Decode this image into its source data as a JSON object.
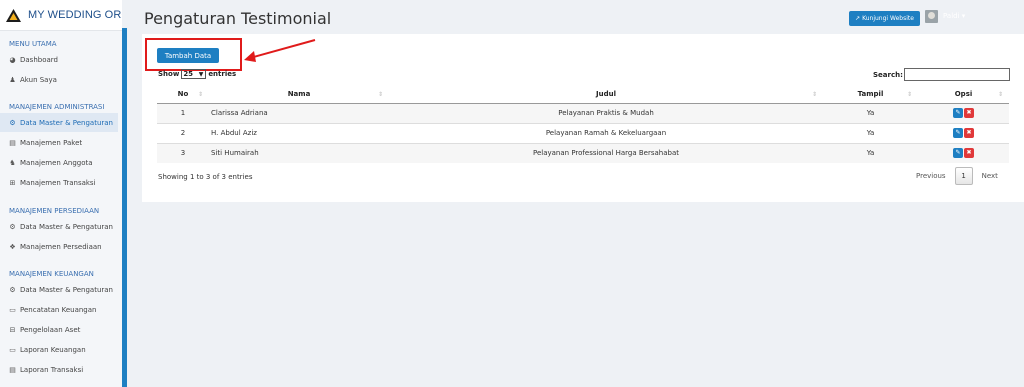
{
  "brand": {
    "name": "MY WEDDING ORGAN"
  },
  "sidebar": {
    "sections": [
      {
        "title": "MENU UTAMA",
        "items": [
          {
            "label": "Dashboard",
            "icon": "dashboard-icon",
            "glyph": "◕"
          },
          {
            "label": "Akun Saya",
            "icon": "user-icon",
            "glyph": "♟"
          }
        ]
      },
      {
        "title": "MANAJEMEN ADMINISTRASI",
        "items": [
          {
            "label": "Data Master & Pengaturan",
            "icon": "cogs-icon",
            "glyph": "⚙"
          },
          {
            "label": "Manajemen Paket",
            "icon": "book-icon",
            "glyph": "▤"
          },
          {
            "label": "Manajemen Anggota",
            "icon": "users-icon",
            "glyph": "♞"
          },
          {
            "label": "Manajemen Transaksi",
            "icon": "cart-icon",
            "glyph": "⊞"
          }
        ]
      },
      {
        "title": "MANAJEMEN PERSEDIAAN",
        "items": [
          {
            "label": "Data Master & Pengaturan",
            "icon": "cogs-icon",
            "glyph": "⚙"
          },
          {
            "label": "Manajemen Persediaan",
            "icon": "cubes-icon",
            "glyph": "❖"
          }
        ]
      },
      {
        "title": "MANAJEMEN KEUANGAN",
        "items": [
          {
            "label": "Data Master & Pengaturan",
            "icon": "cogs-icon",
            "glyph": "⚙"
          },
          {
            "label": "Pencatatan Keuangan",
            "icon": "money-icon",
            "glyph": "▭"
          },
          {
            "label": "Pengelolaan Aset",
            "icon": "hdd-icon",
            "glyph": "⊟"
          },
          {
            "label": "Laporan Keuangan",
            "icon": "money-icon",
            "glyph": "▭"
          },
          {
            "label": "Laporan Transaksi",
            "icon": "book-icon",
            "glyph": "▤"
          }
        ]
      }
    ]
  },
  "header": {
    "title": "Pengaturan Testimonial",
    "visit_label": "Kunjungi Website",
    "user_name": "Paldi"
  },
  "toolbar": {
    "add_label": "Tambah Data"
  },
  "table_controls": {
    "show_label": "Show",
    "page_length": "25",
    "entries_label": "entries",
    "search_label": "Search:",
    "search_value": ""
  },
  "table": {
    "headers": [
      "No",
      "Nama",
      "Judul",
      "Tampil",
      "Opsi"
    ],
    "rows": [
      {
        "no": "1",
        "nama": "Clarissa Adriana",
        "judul": "Pelayanan Praktis & Mudah",
        "tampil": "Ya"
      },
      {
        "no": "2",
        "nama": "H. Abdul Aziz",
        "judul": "Pelayanan Ramah & Kekeluargaan",
        "tampil": "Ya"
      },
      {
        "no": "3",
        "nama": "Siti Humairah",
        "judul": "Pelayanan Professional Harga Bersahabat",
        "tampil": "Ya"
      }
    ]
  },
  "footer": {
    "info": "Showing 1 to 3 of 3 entries",
    "prev": "Previous",
    "page": "1",
    "next": "Next"
  },
  "colors": {
    "primary": "#1e7fc2",
    "danger": "#e0393a",
    "highlight": "#e01b1b"
  }
}
